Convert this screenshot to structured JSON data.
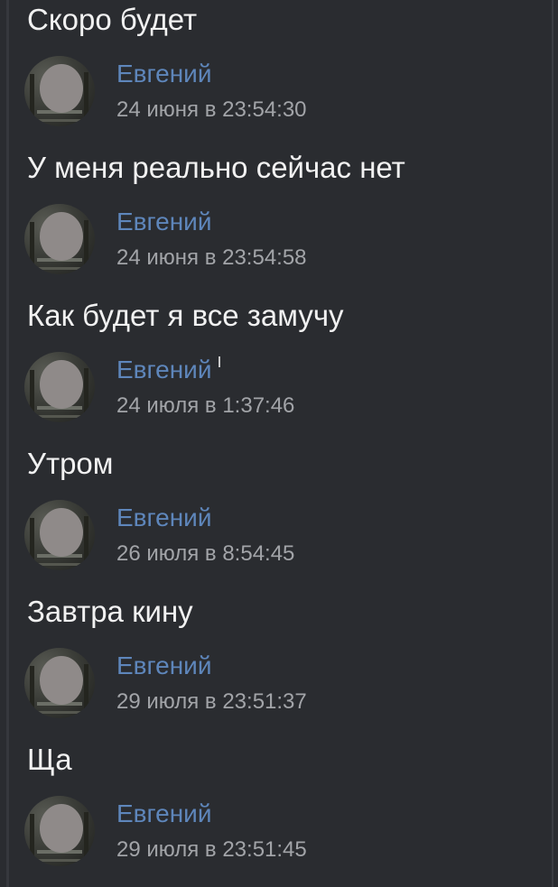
{
  "messages": [
    {
      "text": "Скоро будет"
    },
    {
      "author": "Евгений",
      "time": "24 июня в 23:54:30",
      "text": "У меня реально сейчас нет"
    },
    {
      "author": "Евгений",
      "time": "24 июня в 23:54:58",
      "text": "Как будет я все замучу"
    },
    {
      "author": "Евгений",
      "time": "24 июля в 1:37:46",
      "text": "Утром"
    },
    {
      "author": "Евгений",
      "time": "26 июля в 8:54:45",
      "text": "Завтра кину"
    },
    {
      "author": "Евгений",
      "time": "29 июля в 23:51:37",
      "text": "Ща"
    },
    {
      "author": "Евгений",
      "time": "29 июля в 23:51:45"
    }
  ],
  "colors": {
    "background": "#2a2c30",
    "author": "#5e86bb",
    "text": "#f1f1f1",
    "timestamp": "#a2a4a8"
  },
  "icons": {
    "avatar": "user-avatar-icon"
  }
}
